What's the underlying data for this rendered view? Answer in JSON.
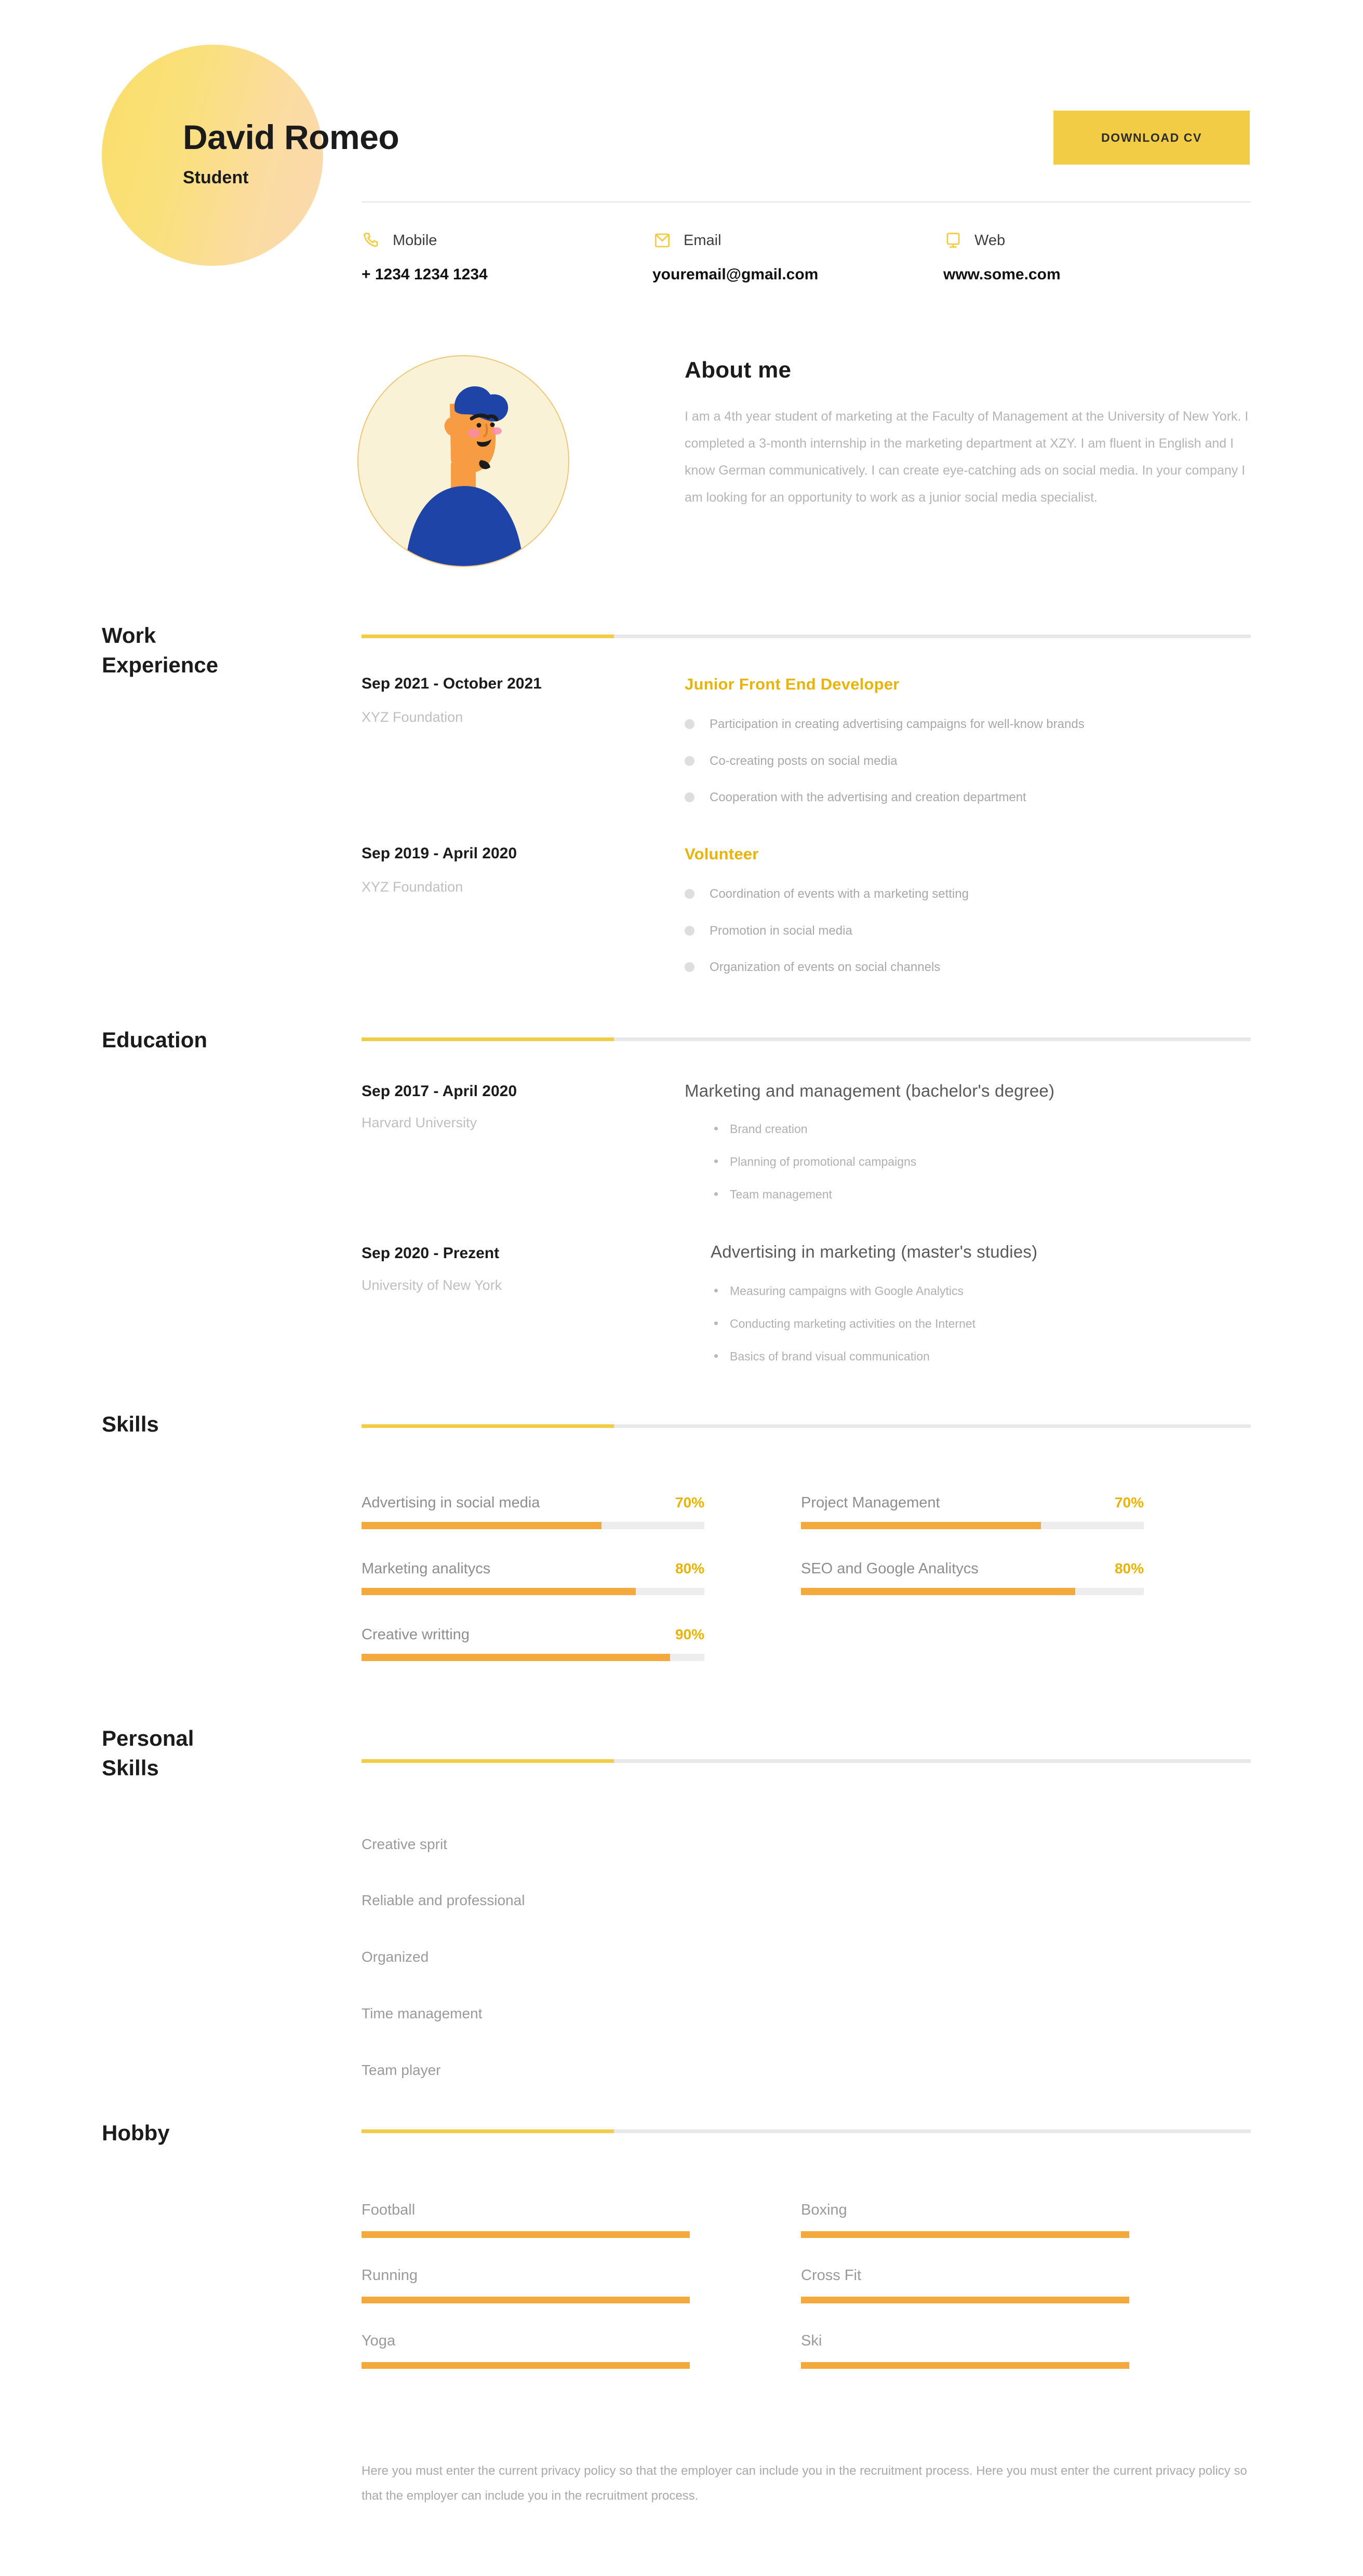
{
  "header": {
    "name": "David Romeo",
    "subtitle": "Student",
    "download_label": "DOWNLOAD CV",
    "accent_yellow": "#F2CC45",
    "accent_orange": "#F4A93D"
  },
  "contact": [
    {
      "icon": "phone-icon",
      "label": "Mobile",
      "value": "+ 1234 1234 1234"
    },
    {
      "icon": "envelope-icon",
      "label": "Email",
      "value": "youremail@gmail.com"
    },
    {
      "icon": "monitor-icon",
      "label": "Web",
      "value": "www.some.com"
    }
  ],
  "about": {
    "title": "About me",
    "text": "I am a 4th year student of marketing at the Faculty of Management at the University of New York. I completed a 3-month internship in the marketing department at XZY. I am fluent in English and I know German communicatively. I can create eye-catching ads on social media. In your company I am looking for an opportunity to work as a junior social media specialist."
  },
  "work": {
    "label": "Work\nExperience",
    "label_line1": "Work",
    "label_line2": "Experience",
    "entries": [
      {
        "date": "Sep 2021 - October 2021",
        "org": "XYZ Foundation",
        "role": "Junior Front End Developer",
        "bullets": [
          "Participation in creating advertising campaigns for well-know brands",
          "Co-creating posts on social media",
          "Cooperation with the advertising and creation department"
        ]
      },
      {
        "date": "Sep 2019 - April 2020",
        "org": "XYZ Foundation",
        "role": "Volunteer",
        "bullets": [
          "Coordination of events with a marketing setting",
          "Promotion in social media",
          "Organization of events on social channels"
        ]
      }
    ]
  },
  "education": {
    "label": "Education",
    "entries": [
      {
        "date": "Sep 2017 - April 2020",
        "org": "Harvard University",
        "degree": "Marketing and management (bachelor's degree)",
        "bullets": [
          "Brand creation",
          "Planning of promotional campaigns",
          "Team management"
        ]
      },
      {
        "date": "Sep 2020 - Prezent",
        "org": "University of New York",
        "degree": "Advertising in marketing (master's studies)",
        "bullets": [
          "Measuring campaigns with Google Analytics",
          "Conducting marketing activities on the Internet",
          "Basics of brand visual communication"
        ]
      }
    ]
  },
  "skills": {
    "label": "Skills",
    "items": [
      {
        "name": "Advertising in social media",
        "percent": "70%",
        "value": 70
      },
      {
        "name": "Project Management",
        "percent": "70%",
        "value": 70
      },
      {
        "name": "Marketing analitycs",
        "percent": "80%",
        "value": 80
      },
      {
        "name": "SEO and Google Analitycs",
        "percent": "80%",
        "value": 80
      },
      {
        "name": "Creative writting",
        "percent": "90%",
        "value": 90
      }
    ]
  },
  "personal_skills": {
    "label_line1": "Personal",
    "label_line2": "Skills",
    "items": [
      "Creative sprit",
      "Reliable and professional",
      "Organized",
      "Time management",
      "Team player"
    ]
  },
  "hobby": {
    "label": "Hobby",
    "items": [
      "Football",
      "Boxing",
      "Running",
      "Cross Fit",
      "Yoga",
      "Ski"
    ]
  },
  "footer": {
    "note": "Here you must enter the current privacy policy so that the employer can include you in the recruitment process. Here you must enter the current privacy policy so that the employer can include you in the recruitment process."
  }
}
